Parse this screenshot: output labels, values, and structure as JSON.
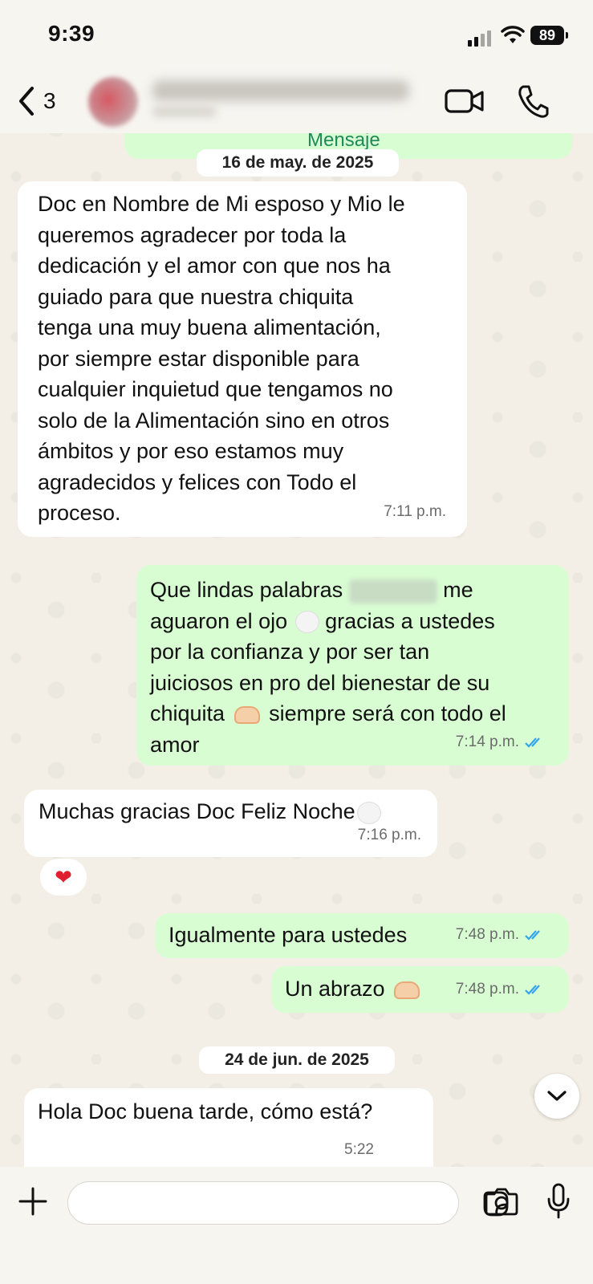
{
  "status_bar": {
    "time": "9:39",
    "battery": "89"
  },
  "header": {
    "back_count": "3"
  },
  "dates": [
    "16 de may. de 2025",
    "24 de jun. de 2025"
  ],
  "top_partial": "Mensaje",
  "messages": [
    {
      "direction": "in",
      "text": "Doc en Nombre de Mi esposo y Mio le\nqueremos agradecer por toda la\ndedicación y el amor con que nos ha\nguiado para que nuestra chiquita\ntenga una muy buena alimentación,\npor siempre estar disponible para\ncualquier inquietud que tengamos no\nsolo de la Alimentación sino en otros\námbitos y por eso estamos muy\nagradecidos y felices con Todo el\nproceso.",
      "time": "7:11 p.m."
    },
    {
      "direction": "out",
      "line1_a": "Que lindas palabras ",
      "line1_b": " me",
      "line2_a": "aguaron el ojo ",
      "line2_b": " gracias a ustedes",
      "line3": "por la confianza y por ser tan",
      "line4": "juiciosos en pro del bienestar de su",
      "line5_a": "chiquita ",
      "line5_b": " siempre será con todo el",
      "line6": "amor",
      "time": "7:14 p.m."
    },
    {
      "direction": "in",
      "text": "Muchas gracias Doc Feliz Noche",
      "time": "7:16 p.m.",
      "reaction": "❤"
    },
    {
      "direction": "out",
      "text": "Igualmente para ustedes",
      "time": "7:48 p.m."
    },
    {
      "direction": "out",
      "text": "Un abrazo ",
      "time": "7:48 p.m."
    },
    {
      "direction": "in",
      "text": "Hola Doc buena tarde, cómo  está?",
      "time": "5:22"
    }
  ],
  "composer": {
    "placeholder": ""
  },
  "colors": {
    "incoming": "#ffffff",
    "outgoing": "#d9fdd3",
    "ticks": "#34a4f0"
  },
  "icons": [
    "back-chevron-icon",
    "video-call-icon",
    "phone-icon",
    "plus-icon",
    "sticker-icon",
    "camera-icon",
    "microphone-icon",
    "chevron-down-icon",
    "double-check-icon"
  ]
}
